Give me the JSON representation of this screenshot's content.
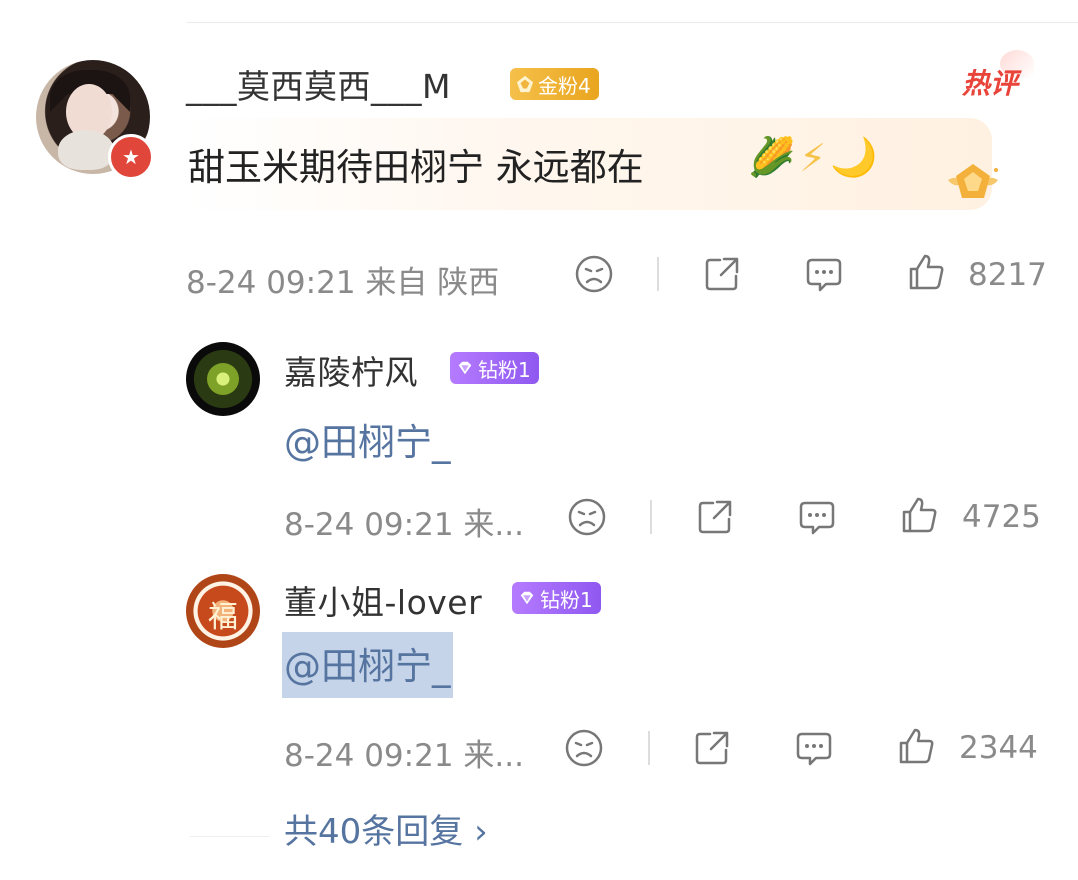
{
  "top_comment": {
    "username": "___莫西莫西___M",
    "fan_badge": "金粉4",
    "hot_label": "热评",
    "text": "甜玉米期待田栩宁 永远都在",
    "emojis": [
      "🌽",
      "⚡",
      "🌙"
    ],
    "meta": "8-24 09:21 来自 陕西",
    "like_count": "8217",
    "colors": {
      "gold_badge": "#f0b53a",
      "hot_red": "#e8443a"
    }
  },
  "replies": [
    {
      "username": "嘉陵柠风",
      "fan_badge": "钻粉1",
      "text": "@田栩宁_",
      "meta": "8-24 09:21 来...",
      "like_count": "4725"
    },
    {
      "username": "董小姐-lover",
      "fan_badge": "钻粉1",
      "avatar_text": "福",
      "text": "@田栩宁_",
      "meta": "8-24 09:21 来...",
      "like_count": "2344"
    }
  ],
  "more_replies_label": "共40条回复 ›",
  "colors": {
    "mention_blue": "#5674a0",
    "diamond_badge": "#a56cf8",
    "meta_gray": "#8a8a8a"
  }
}
